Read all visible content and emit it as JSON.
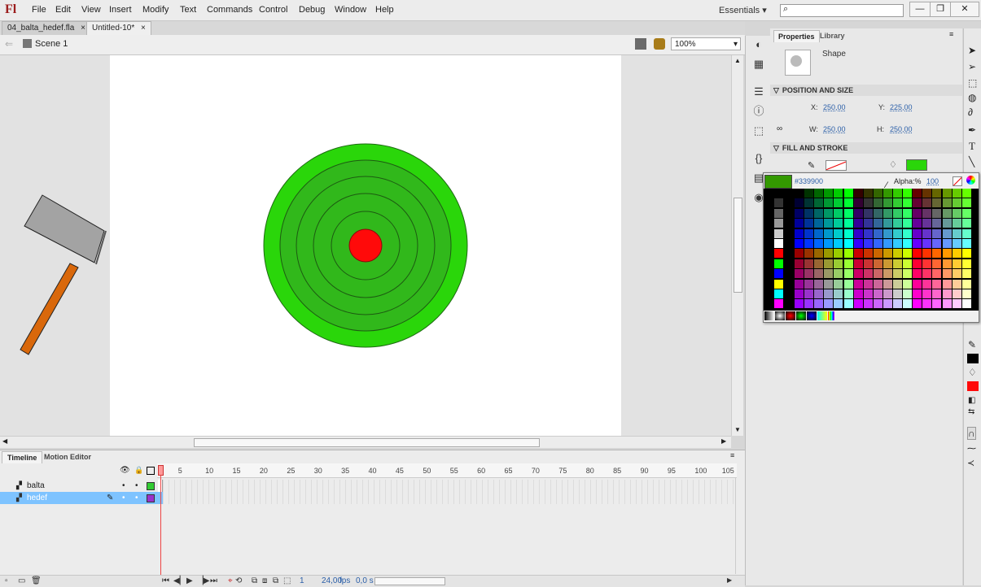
{
  "app": {
    "logo": "Fl"
  },
  "menu": [
    "File",
    "Edit",
    "View",
    "Insert",
    "Modify",
    "Text",
    "Commands",
    "Control",
    "Debug",
    "Window",
    "Help"
  ],
  "workspace": "Essentials",
  "search": {
    "placeholder": ""
  },
  "window_controls": [
    "—",
    "❐",
    "✕"
  ],
  "doc_tabs": [
    {
      "label": "04_balta_hedef.fla",
      "close": "×"
    },
    {
      "label": "Untitled-10*",
      "close": "×"
    }
  ],
  "editbar": {
    "scene": "Scene 1",
    "zoom": "100%"
  },
  "properties": {
    "tabs": [
      "Properties",
      "Library"
    ],
    "object_type": "Shape",
    "pos_size_header": "POSITION AND SIZE",
    "x_label": "X:",
    "x_value": "250,00",
    "y_label": "Y:",
    "y_value": "225,00",
    "w_label": "W:",
    "w_value": "250,00",
    "h_label": "H:",
    "h_value": "250,00",
    "fill_stroke_header": "FILL AND STROKE"
  },
  "swatch": {
    "hex": "#339900",
    "alpha_label": "Alpha:%",
    "alpha_value": "100",
    "current_color": "#339900"
  },
  "stage_colors": {
    "target_outer": "#2ad60a",
    "target_ring": "#31b81b",
    "target_center": "#ff0a0a",
    "axe_head": "#a3a3a3",
    "axe_handle": "#d9680b"
  },
  "timeline": {
    "tabs": [
      "Timeline",
      "Motion Editor"
    ],
    "layers": [
      {
        "name": "balta",
        "color": "#33cc33"
      },
      {
        "name": "hedef",
        "color": "#9933cc"
      }
    ],
    "frame_numbers": [
      "1",
      "5",
      "10",
      "15",
      "20",
      "25",
      "30",
      "35",
      "40",
      "45",
      "50",
      "55",
      "60",
      "65",
      "70",
      "75",
      "80",
      "85",
      "90",
      "95",
      "100",
      "105"
    ],
    "status": {
      "frame": "1",
      "fps": "24,00",
      "fps_unit": "fps",
      "time": "0,0 s"
    }
  }
}
